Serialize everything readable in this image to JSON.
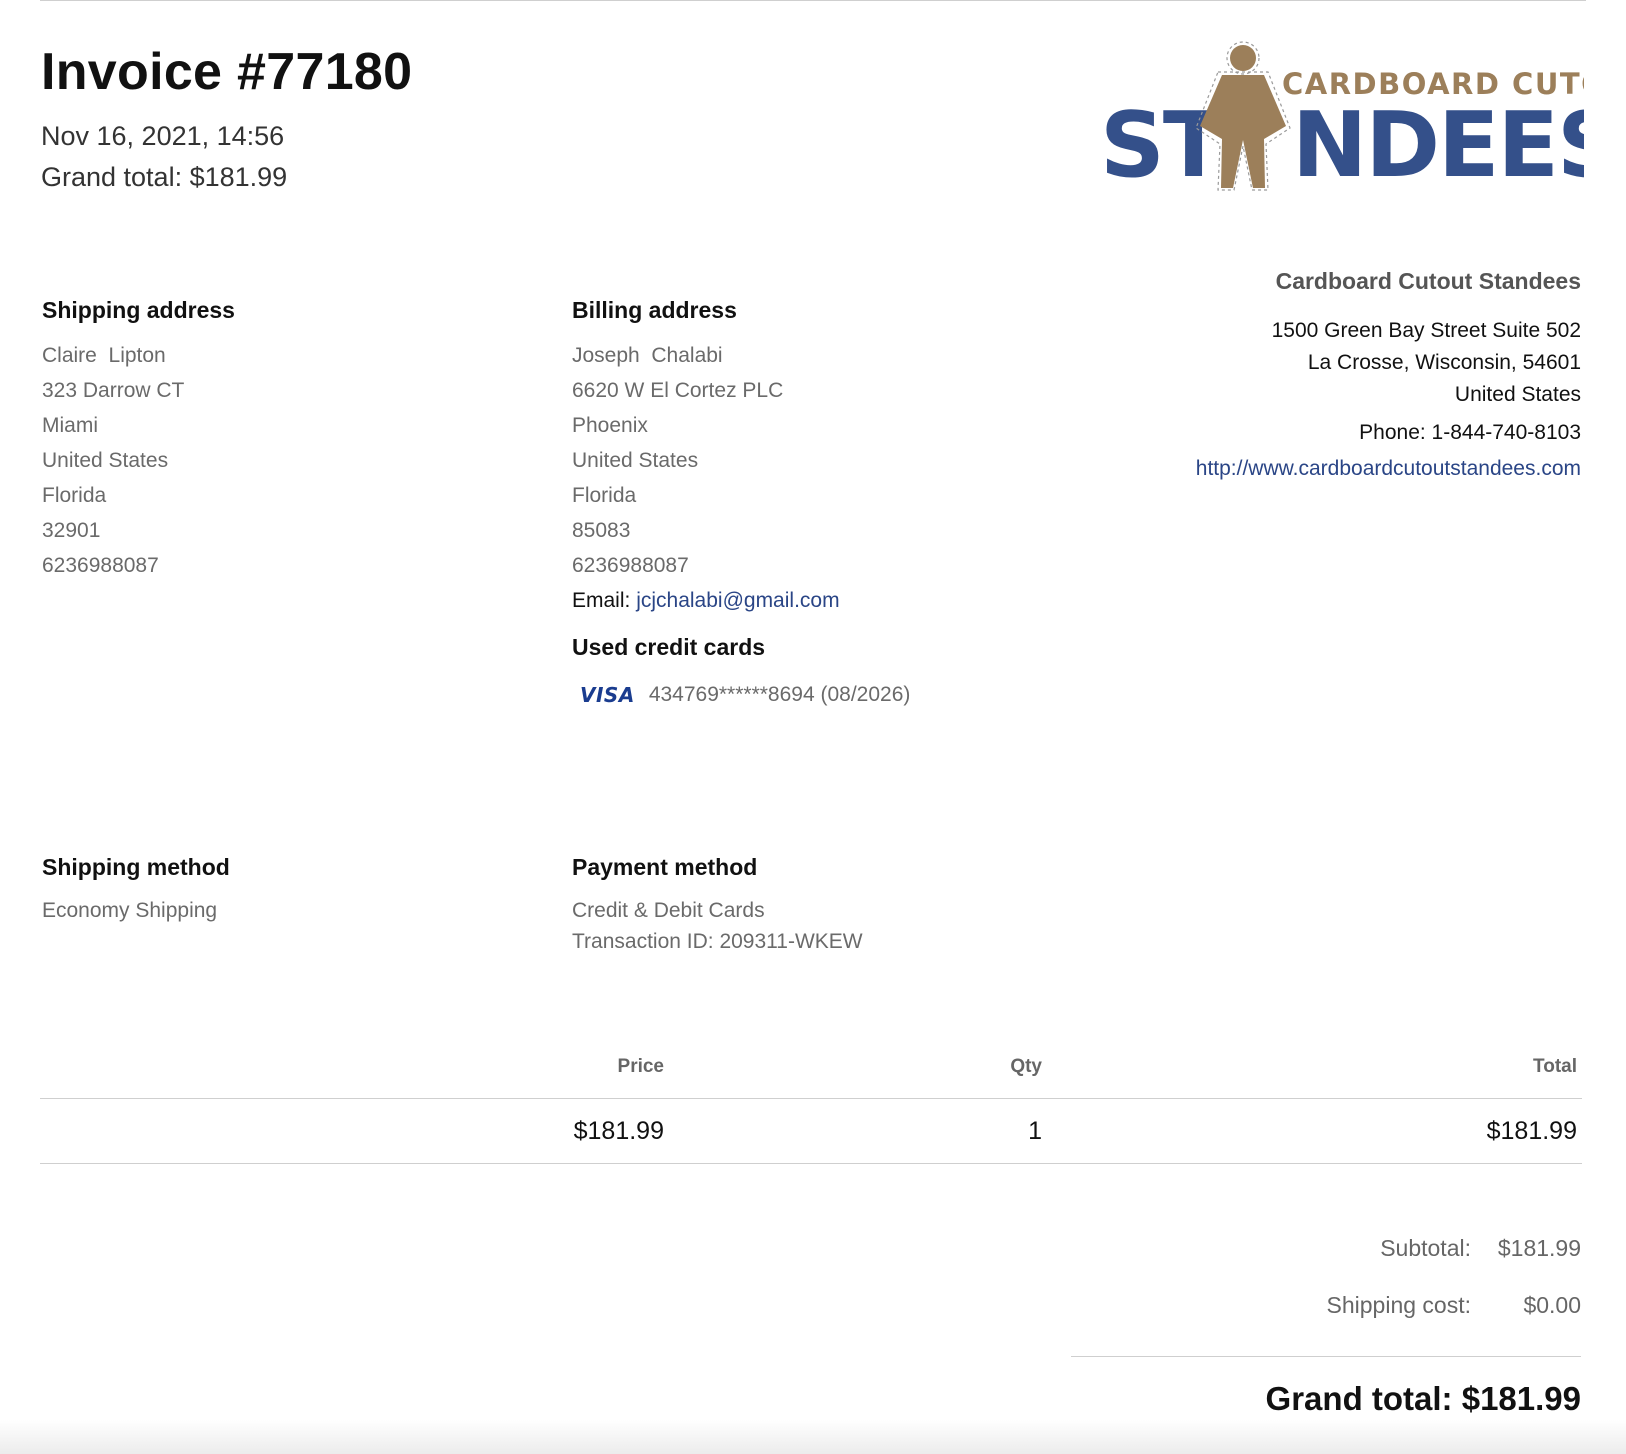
{
  "invoice": {
    "title": "Invoice #77180",
    "date": "Nov 16, 2021, 14:56",
    "grand_total_line": "Grand total: $181.99"
  },
  "logo": {
    "top_text": "CARDBOARD CUTOUT",
    "word_start": "ST",
    "word_end": "NDEES",
    "colors": {
      "navy": "#34508a",
      "tan": "#9c7f5a"
    }
  },
  "company": {
    "name": "Cardboard Cutout Standees",
    "address_lines": [
      "1500 Green Bay Street Suite 502",
      "La Crosse, Wisconsin, 54601",
      "United States"
    ],
    "phone": "Phone: 1-844-740-8103",
    "url": "http://www.cardboardcutoutstandees.com"
  },
  "shipping_address": {
    "heading": "Shipping address",
    "lines": [
      "Claire  Lipton",
      "323 Darrow CT",
      "Miami",
      "United States",
      "Florida",
      "32901",
      "6236988087"
    ]
  },
  "billing_address": {
    "heading": "Billing address",
    "lines": [
      "Joseph  Chalabi",
      "6620 W El Cortez PLC",
      "Phoenix",
      "United States",
      "Florida",
      "85083",
      "6236988087"
    ],
    "email_label": "Email: ",
    "email": "jcjchalabi@gmail.com"
  },
  "credit_cards": {
    "heading": "Used credit cards",
    "brand": "VISA",
    "number": "434769******8694 (08/2026)"
  },
  "shipping_method": {
    "heading": "Shipping method",
    "value": "Economy Shipping"
  },
  "payment_method": {
    "heading": "Payment method",
    "value": "Credit & Debit Cards",
    "transaction": "Transaction ID: 209311-WKEW"
  },
  "items_table": {
    "headers": {
      "price": "Price",
      "qty": "Qty",
      "total": "Total"
    },
    "rows": [
      {
        "price": "$181.99",
        "qty": "1",
        "total": "$181.99"
      }
    ]
  },
  "totals": {
    "subtotal_label": "Subtotal:",
    "subtotal": "$181.99",
    "shipping_label": "Shipping cost:",
    "shipping": "$0.00",
    "grand_total": "Grand total: $181.99"
  }
}
